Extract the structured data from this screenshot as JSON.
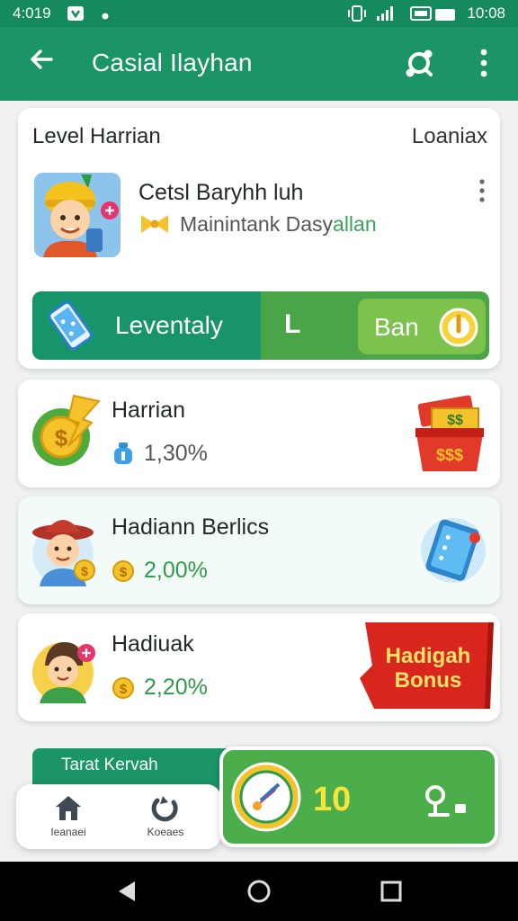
{
  "status_bar": {
    "time": "4:019",
    "clock": "10:08"
  },
  "app_bar": {
    "title": "Casial Ilayhan",
    "back_icon": "arrow-left-icon",
    "share_icon": "share-icon",
    "more_icon": "more-vert-icon"
  },
  "level_card": {
    "title": "Level Harrian",
    "right_label": "Loaniax",
    "name": "Cetsl Baryhh luh",
    "subtitle_prefix": "Mainintank Dasy",
    "subtitle_suffix": "allan",
    "action_left_label": "Leventaly",
    "action_mid_label": "L",
    "action_right_label": "Ban"
  },
  "rewards": [
    {
      "title": "Harrian",
      "percent": "1,30%"
    },
    {
      "title": "Hadiann Berlics",
      "percent": "2,00%"
    },
    {
      "title": "Hadiuak",
      "percent": "2,20%"
    }
  ],
  "bonus_banner": {
    "line1": "Hadigah",
    "line2": "Bonus"
  },
  "bottom": {
    "strip_label": "Tarat Kervah",
    "nav_items": [
      {
        "label": "Ieanaei",
        "icon": "home-icon"
      },
      {
        "label": "Koeaes",
        "icon": "refresh-icon"
      }
    ],
    "score_value": "10"
  },
  "colors": {
    "primary": "#1b9565",
    "accent_green": "#4cae4a",
    "bonus_red": "#d8261e",
    "score_yellow": "#f5e43a"
  }
}
